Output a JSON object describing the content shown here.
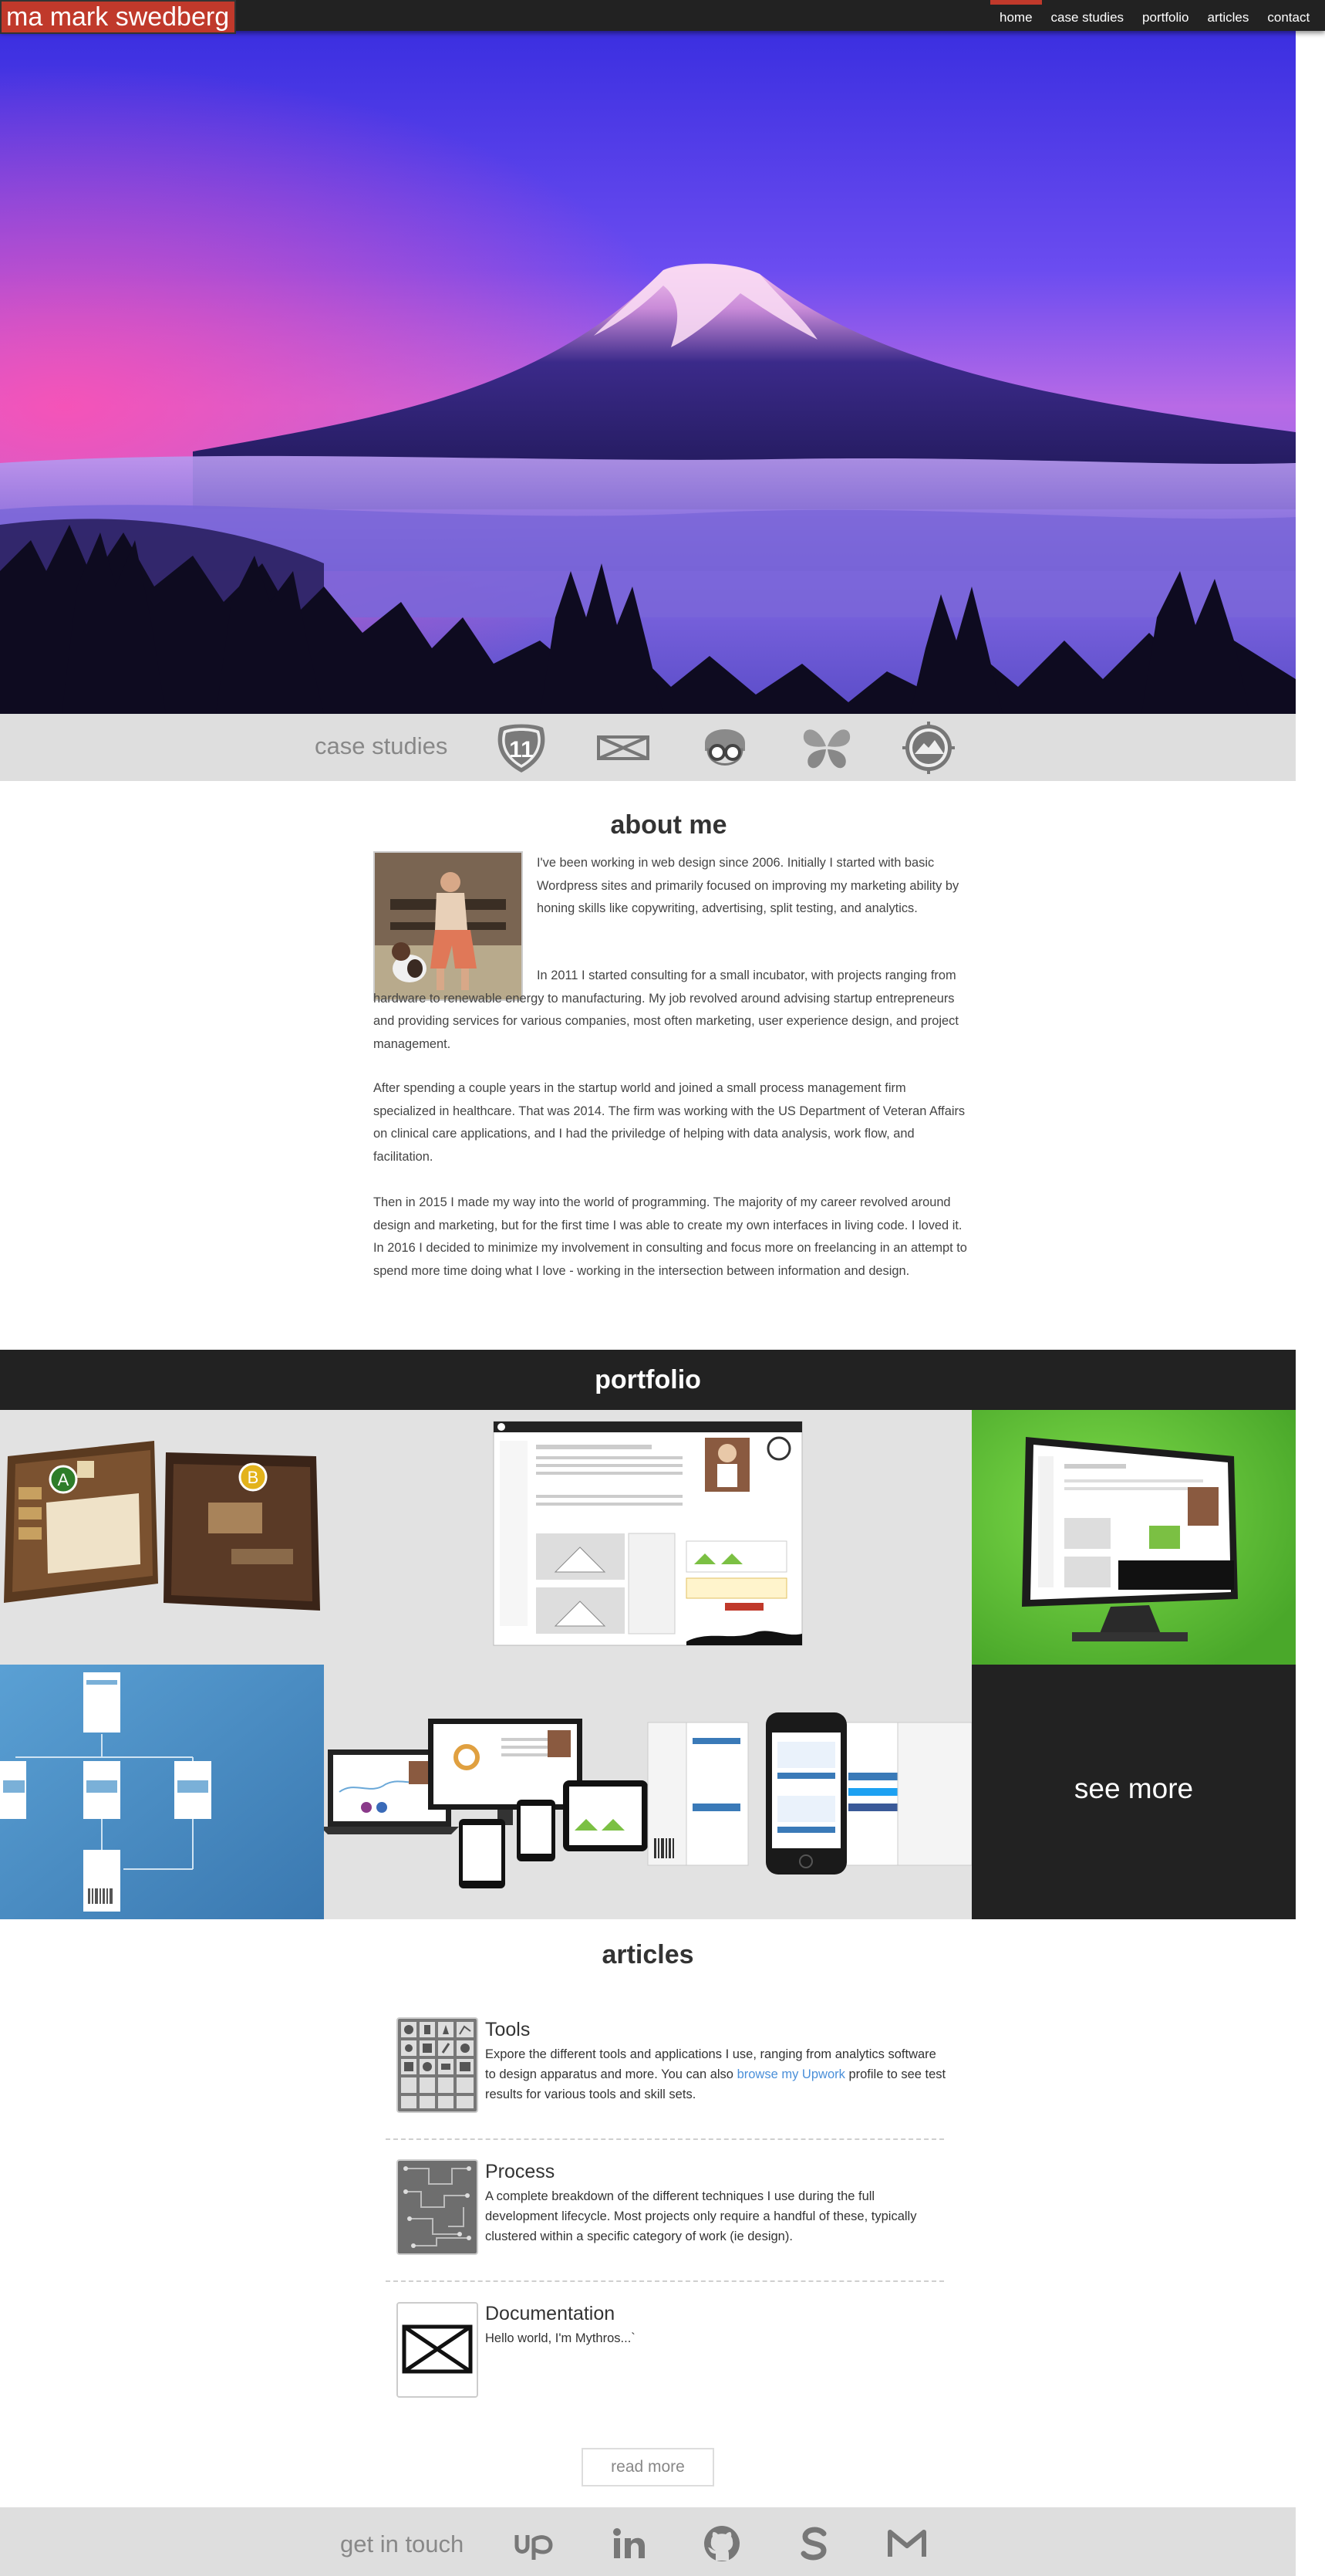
{
  "nav": {
    "brand_prefix": "ma",
    "brand_name": "mark swedberg",
    "links": [
      {
        "label": "home",
        "active": true
      },
      {
        "label": "case studies"
      },
      {
        "label": "portfolio"
      },
      {
        "label": "articles"
      },
      {
        "label": "contact"
      }
    ]
  },
  "case_studies": {
    "title": "case studies",
    "icons": [
      "route-11-shield-icon",
      "bowtie-icon",
      "glasses-character-icon",
      "butterfly-icon",
      "mountain-compass-icon"
    ]
  },
  "about": {
    "title": "about me",
    "paragraphs": [
      "I've been working in web design since 2006. Initially I started with basic Wordpress sites and primarily focused on improving my marketing ability by honing skills like copywriting, advertising, split testing, and analytics.",
      "In 2011 I started consulting for a small incubator, with projects ranging from hardware to renewable energy to manufacturing. My job revolved around advising startup entrepreneurs and providing services for various companies, most often marketing, user experience design, and project management.",
      "After spending a couple years in the startup world and joined a small process management firm specialized in healthcare. That was 2014. The firm was working with the US Department of Veteran Affairs on clinical care applications, and I had the priviledge of helping with data analysis, work flow, and facilitation.",
      "Then in 2015 I made my way into the world of programming. The majority of my career revolved around design and marketing, but for the first time I was able to create my own interfaces in living code. I loved it. In 2016 I decided to minimize my involvement in consulting and focus more on freelancing in an attempt to spend more time doing what I love - working in the intersection between information and design."
    ]
  },
  "portfolio": {
    "title": "portfolio",
    "see_more": "see more",
    "badges": [
      "A",
      "B"
    ]
  },
  "articles": {
    "title": "articles",
    "items": [
      {
        "title": "Tools",
        "desc_before": "Expore the different tools and applications I use, ranging from analytics software to design apparatus and more. You can also ",
        "link": "browse my Upwork",
        "desc_after": " profile to see test results for various tools and skill sets."
      },
      {
        "title": "Process",
        "desc": "A complete breakdown of the different techniques I use during the full development lifecycle. Most projects only require a handful of these, typically clustered within a specific category of work (ie design)."
      },
      {
        "title": "Documentation",
        "desc": "Hello world, I'm Mythros...`"
      }
    ],
    "read_more": "read more"
  },
  "footer": {
    "title": "get in touch",
    "icons": [
      "upwork-icon",
      "linkedin-icon",
      "github-icon",
      "skype-icon",
      "gmail-icon"
    ]
  },
  "colors": {
    "accent": "#c0392b",
    "dark": "#222222",
    "strip": "#dedede",
    "link": "#4a8fd9",
    "green_tile": "#6fce3f",
    "blue_tile": "#4a8fc4"
  }
}
